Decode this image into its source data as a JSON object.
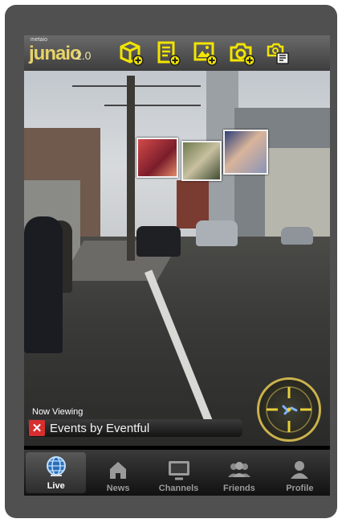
{
  "app": {
    "logo_text": "junaio",
    "logo_version": "2.0",
    "logo_sub": "metaio"
  },
  "toolbar": {
    "buttons": [
      {
        "icon": "3d-box-add-icon",
        "label": "Add 3D object"
      },
      {
        "icon": "text-note-add-icon",
        "label": "Add note"
      },
      {
        "icon": "image-add-icon",
        "label": "Add image"
      },
      {
        "icon": "camera-add-icon",
        "label": "Add photo"
      },
      {
        "icon": "screenshot-icon",
        "label": "Snapshot"
      }
    ],
    "colors": {
      "icon": "#f2e400",
      "bar_top": "#6a6a6a",
      "bar_bottom": "#3e3e3e"
    }
  },
  "now_viewing": {
    "tag": "Now Viewing",
    "channel": "Events by Eventful",
    "close_color": "#d72e2e"
  },
  "radar": {
    "ring_color": "#cbb24c",
    "icon": "compass-radar-icon"
  },
  "tabs": [
    {
      "label": "Live",
      "icon": "globe-icon",
      "active": true
    },
    {
      "label": "News",
      "icon": "home-icon",
      "active": false
    },
    {
      "label": "Channels",
      "icon": "tv-icon",
      "active": false
    },
    {
      "label": "Friends",
      "icon": "friends-icon",
      "active": false
    },
    {
      "label": "Profile",
      "icon": "person-icon",
      "active": false
    }
  ]
}
